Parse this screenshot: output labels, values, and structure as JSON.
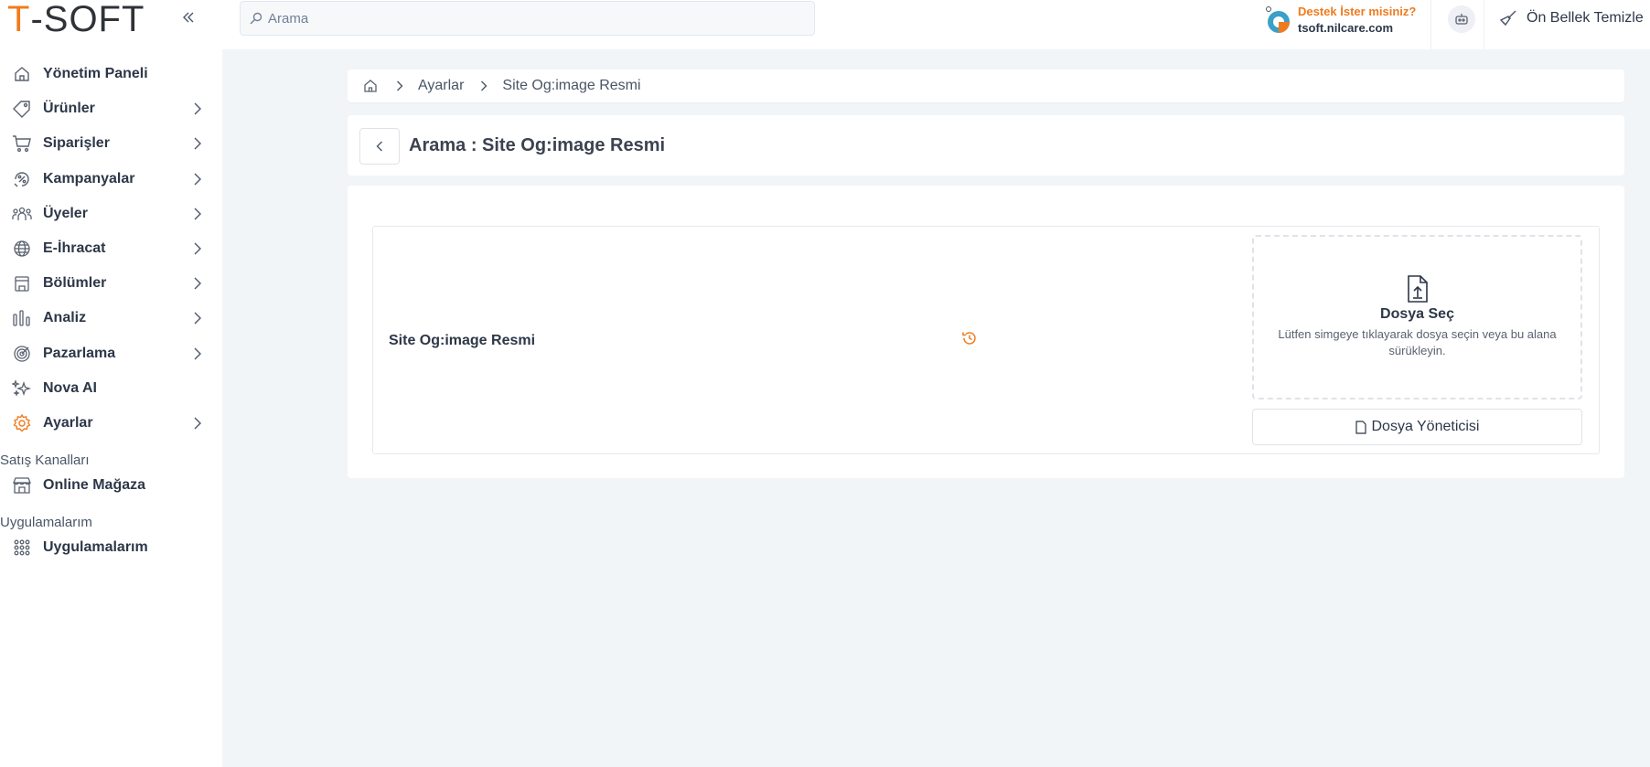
{
  "brand": {
    "logo_first": "T",
    "logo_rest": "-SOFT"
  },
  "search": {
    "placeholder": "Arama"
  },
  "header": {
    "support_question": "Destek İster misiniz?",
    "support_domain": "tsoft.nilcare.com",
    "cache_label": "Ön Bellek Temizle"
  },
  "sidebar": {
    "items": [
      {
        "label": "Yönetim Paneli",
        "icon": "home-icon"
      },
      {
        "label": "Ürünler",
        "icon": "tag-icon"
      },
      {
        "label": "Siparişler",
        "icon": "cart-icon"
      },
      {
        "label": "Kampanyalar",
        "icon": "discount-icon"
      },
      {
        "label": "Üyeler",
        "icon": "users-icon"
      },
      {
        "label": "E-İhracat",
        "icon": "globe-icon"
      },
      {
        "label": "Bölümler",
        "icon": "calendar-icon"
      },
      {
        "label": "Analiz",
        "icon": "chart-icon"
      },
      {
        "label": "Pazarlama",
        "icon": "target-icon"
      },
      {
        "label": "Nova AI",
        "icon": "sparkles-icon"
      },
      {
        "label": "Ayarlar",
        "icon": "gear-icon"
      }
    ],
    "section_channels": "Satış Kanalları",
    "online_store": "Online Mağaza",
    "section_apps": "Uygulamalarım",
    "apps": "Uygulamalarım"
  },
  "breadcrumb": {
    "items": [
      "Ayarlar",
      "Site Og:image Resmi"
    ]
  },
  "page": {
    "title": "Arama : Site Og:image Resmi"
  },
  "field": {
    "label": "Site Og:image Resmi",
    "dropzone_title": "Dosya Seç",
    "dropzone_hint": "Lütfen simgeye tıklayarak dosya seçin veya bu alana sürükleyin.",
    "file_manager": "Dosya Yöneticisi"
  },
  "colors": {
    "accent": "#f07b1e",
    "background": "#f1f5f7",
    "text": "#2d3748"
  }
}
